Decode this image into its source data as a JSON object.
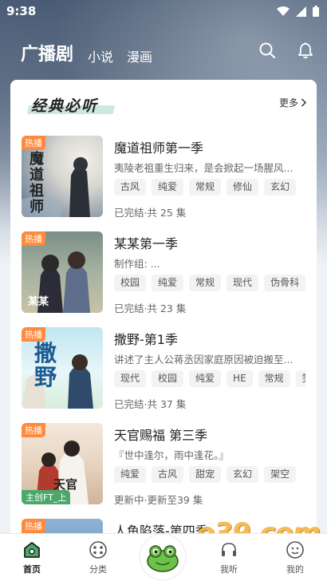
{
  "status": {
    "time": "9:38"
  },
  "nav": {
    "main": "广播剧",
    "sub1": "小说",
    "sub2": "漫画"
  },
  "section": {
    "title": "经典必听",
    "more": "更多"
  },
  "items": [
    {
      "badge": "热播",
      "cover_text": "魔道祖师",
      "title": "魔道祖师第一季",
      "desc": "夷陵老祖重生归来，是会掀起一场腥风...",
      "tags": [
        "古风",
        "纯爱",
        "常规",
        "修仙",
        "玄幻"
      ],
      "status": "已完结·共 25 集"
    },
    {
      "badge": "热播",
      "cover_text": "某某",
      "title": "某某第一季",
      "desc": "制作组: ...",
      "tags": [
        "校园",
        "纯爱",
        "常规",
        "现代",
        "伪骨科"
      ],
      "status": "已完结·共 23 集"
    },
    {
      "badge": "热播",
      "cover_text": "撒野",
      "title": "撒野-第1季",
      "desc": "讲述了主人公蒋丞因家庭原因被迫搬至...",
      "tags": [
        "现代",
        "校园",
        "纯爱",
        "HE",
        "常规",
        "笑"
      ],
      "status": "已完结·共 37 集"
    },
    {
      "badge": "热播",
      "cover_text": "天官",
      "cover_sub": "主创FT_上",
      "title": "天官赐福 第三季",
      "desc": "『世中逢尔，雨中逢花。』",
      "tags": [
        "纯爱",
        "古风",
        "甜宠",
        "玄幻",
        "架空"
      ],
      "status": "更新中·更新至39 集"
    },
    {
      "badge": "热播",
      "title": "人鱼陷落-第四季"
    }
  ],
  "tabbar": {
    "home": "首页",
    "category": "分类",
    "listen": "我听",
    "mine": "我的"
  },
  "watermark": "e39.com",
  "colors": {
    "badge": "#ff8a3d",
    "accent_green": "#4aa86a",
    "highlight": "#cfe8dd"
  }
}
